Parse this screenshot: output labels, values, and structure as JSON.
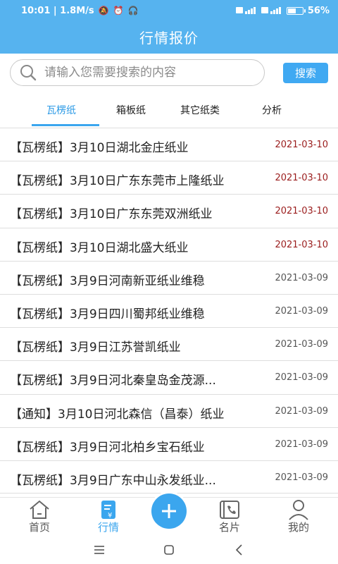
{
  "status_bar": {
    "time_speed": "10:01 | 1.8M/s",
    "battery": "56",
    "battery_level": 0.56,
    "left_icons": [
      "mute-icon",
      "alarm-icon",
      "headset-icon"
    ],
    "right_icons": [
      "hd-signal-icon",
      "hd-signal-icon",
      "battery-icon"
    ]
  },
  "header": {
    "title": "行情报价",
    "bg_color": "#56b3ef"
  },
  "search": {
    "placeholder": "请输入您需要搜索的内容",
    "value": "",
    "button_label": "搜索"
  },
  "tabs": [
    {
      "label": "瓦楞纸",
      "active": true
    },
    {
      "label": "箱板纸",
      "active": false
    },
    {
      "label": "其它纸类",
      "active": false
    },
    {
      "label": "分析",
      "active": false
    }
  ],
  "list": [
    {
      "title": "【瓦楞纸】3月10日湖北金庄纸业",
      "date": "2021-03-10",
      "highlight": true
    },
    {
      "title": "【瓦楞纸】3月10日广东东莞市上隆纸业",
      "date": "2021-03-10",
      "highlight": true
    },
    {
      "title": "【瓦楞纸】3月10日广东东莞双洲纸业",
      "date": "2021-03-10",
      "highlight": true
    },
    {
      "title": "【瓦楞纸】3月10日湖北盛大纸业",
      "date": "2021-03-10",
      "highlight": true
    },
    {
      "title": "【瓦楞纸】3月9日河南新亚纸业维稳",
      "date": "2021-03-09",
      "highlight": false
    },
    {
      "title": "【瓦楞纸】3月9日四川蜀邦纸业维稳",
      "date": "2021-03-09",
      "highlight": false
    },
    {
      "title": "【瓦楞纸】3月9日江苏誉凯纸业",
      "date": "2021-03-09",
      "highlight": false
    },
    {
      "title": "【瓦楞纸】3月9日河北秦皇岛金茂源...",
      "date": "2021-03-09",
      "highlight": false
    },
    {
      "title": "【通知】3月10日河北森信（昌泰）纸业",
      "date": "2021-03-09",
      "highlight": false
    },
    {
      "title": "【瓦楞纸】3月9日河北柏乡宝石纸业",
      "date": "2021-03-09",
      "highlight": false
    },
    {
      "title": "【瓦楞纸】3月9日广东中山永发纸业...",
      "date": "2021-03-09",
      "highlight": false
    }
  ],
  "bottom_nav": [
    {
      "label": "首页",
      "icon": "home-icon",
      "active": false
    },
    {
      "label": "行情",
      "icon": "quote-icon",
      "active": true
    },
    {
      "label": "名片",
      "icon": "card-icon",
      "active": false
    },
    {
      "label": "我的",
      "icon": "user-icon",
      "active": false
    }
  ],
  "fab_icon": "plus-icon",
  "colors": {
    "accent": "#3ba6ee",
    "new_date": "#9a1c1c",
    "old_date": "#555555"
  }
}
